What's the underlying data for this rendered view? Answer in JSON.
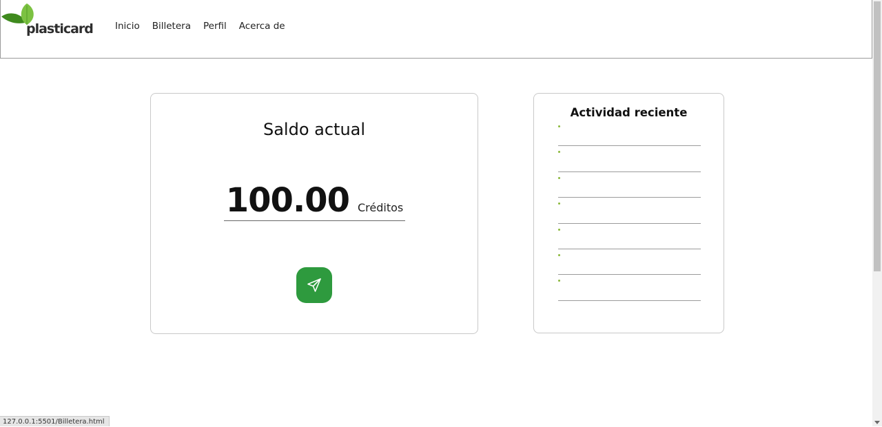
{
  "brand": {
    "name": "plasticard",
    "leaf_color_dark": "#3f8a1e",
    "leaf_color_light": "#7cc242"
  },
  "nav": {
    "items": [
      {
        "label": "Inicio"
      },
      {
        "label": "Billetera"
      },
      {
        "label": "Perfil"
      },
      {
        "label": "Acerca de"
      }
    ]
  },
  "balance": {
    "title": "Saldo actual",
    "amount": "100.00",
    "unit": "Créditos",
    "send_icon": "paper-plane-icon",
    "button_color": "#2e9a3e"
  },
  "activity": {
    "title": "Actividad reciente",
    "items": [
      "",
      "",
      "",
      "",
      "",
      "",
      ""
    ],
    "bullet_color": "#8ab83a"
  },
  "status_bar": {
    "url": "127.0.0.1:5501/Billetera.html"
  }
}
